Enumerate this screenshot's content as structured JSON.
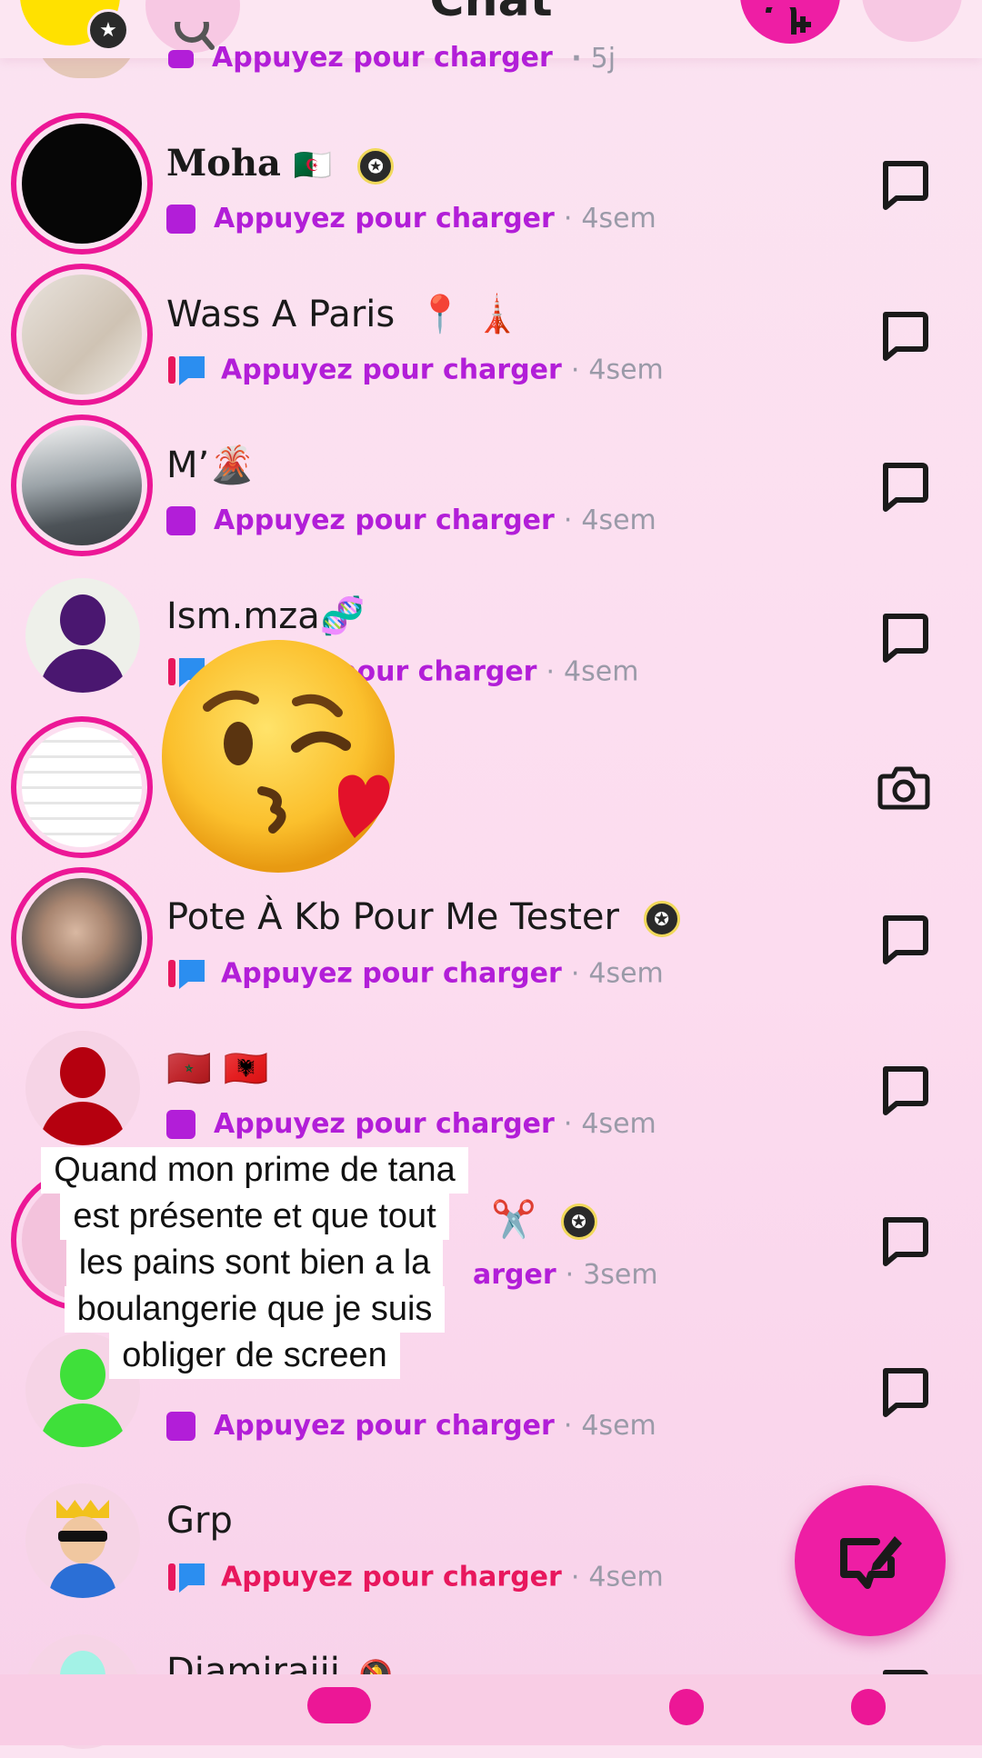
{
  "header": {
    "title": "Chat",
    "partial_row": {
      "status": "Appuyez pour charger",
      "time": "5j"
    }
  },
  "rows": [
    {
      "name": "Moha",
      "flag": "🇩🇿",
      "badge": "✪",
      "status": "Appuyez pour charger",
      "time": "4sem",
      "action": "chat"
    },
    {
      "name": "Wass A Paris",
      "emoji": "📍 🗼",
      "status": "Appuyez pour charger",
      "time": "4sem",
      "action": "chat"
    },
    {
      "name": "M’",
      "emoji": "🌋",
      "status": "Appuyez pour charger",
      "time": "4sem",
      "action": "chat"
    },
    {
      "name": "Ism.mza",
      "emoji": "🧬",
      "status": "pour charger",
      "time": "4sem",
      "action": "chat"
    },
    {
      "name": "",
      "status": "",
      "time": "",
      "action": "camera"
    },
    {
      "name": "Pote À Kb Pour Me Tester",
      "badge": "✪",
      "status": "Appuyez pour charger",
      "time": "4sem",
      "action": "chat"
    },
    {
      "name": "🇲🇦 🇦🇱",
      "status": "Appuyez pour charger",
      "time": "4sem",
      "action": "chat"
    },
    {
      "name": "✂️",
      "badge": "✪",
      "status": "arger",
      "time": "3sem",
      "action": "chat"
    },
    {
      "name": "",
      "status": "Appuyez pour charger",
      "time": "4sem",
      "action": "chat"
    },
    {
      "name": "Grp",
      "status": "Appuyez pour charger",
      "time": "4sem",
      "action": "chat"
    },
    {
      "name": "Djamiraiii",
      "emoji": "🔕"
    }
  ],
  "overlay": {
    "emoji": "😘",
    "caption_lines": [
      "Quand mon prime de tana",
      "est présente  et que tout",
      "les pains sont bien a la",
      "boulangerie que je suis",
      "obliger de screen"
    ]
  },
  "colors": {
    "accent": "#ee1ea4",
    "ring": "#ec1796",
    "status_purple": "#b21ed8",
    "status_red": "#e8175d",
    "timestamp": "#9a9aa8",
    "background": "#fcdcef"
  },
  "icons": {
    "header": [
      "profile-avatar",
      "search-icon",
      "add-friend-icon",
      "more-icon"
    ],
    "row_actions": [
      "chat-bubble-icon",
      "camera-icon"
    ],
    "fab": "new-chat-icon"
  }
}
